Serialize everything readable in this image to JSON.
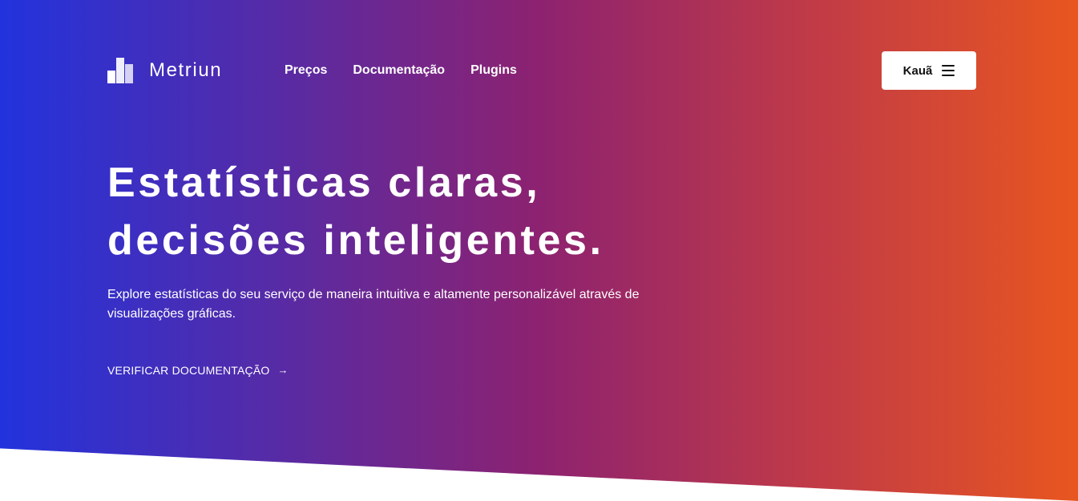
{
  "header": {
    "brand": {
      "name": "Metriun",
      "logo_icon": "stacked-bars-logo-icon"
    },
    "nav": [
      {
        "label": "Preços"
      },
      {
        "label": "Documentação"
      },
      {
        "label": "Plugins"
      }
    ],
    "user_button": {
      "label": "Kauã",
      "icon": "hamburger-menu-icon"
    }
  },
  "hero": {
    "headline_line1": "Estatísticas claras,",
    "headline_line2": "decisões inteligentes.",
    "description": "Explore estatísticas do seu serviço de maneira intuitiva e altamente personalizável através de visualizações gráficas.",
    "cta": {
      "label": "VERIFICAR DOCUMENTAÇÃO",
      "icon": "arrow-right-icon",
      "glyph": "→"
    }
  },
  "colors": {
    "gradient_start": "#2233dd",
    "gradient_mid": "#8d2270",
    "gradient_end": "#e8561f",
    "text": "#ffffff",
    "button_bg": "#ffffff",
    "button_text": "#111111"
  }
}
